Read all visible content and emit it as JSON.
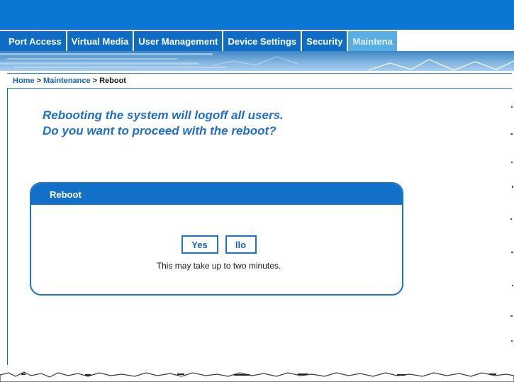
{
  "tabs": [
    {
      "label": "Port Access",
      "active": false
    },
    {
      "label": "Virtual Media",
      "active": false
    },
    {
      "label": "User Management",
      "active": false
    },
    {
      "label": "Device Settings",
      "active": false
    },
    {
      "label": "Security",
      "active": false
    },
    {
      "label": "Maintena",
      "active": true
    }
  ],
  "breadcrumb": {
    "home": "Home",
    "sep1": ">",
    "section": "Maintenance",
    "sep2": ">",
    "current": "Reboot"
  },
  "message": {
    "line1": "Rebooting the system will logoff all users.",
    "line2": "Do you want to proceed with the reboot?"
  },
  "panel": {
    "title": "Reboot",
    "yes_label": "Yes",
    "no_label": "llo",
    "note": "This may take up to two minutes."
  },
  "colors": {
    "brand_blue": "#0a78d2",
    "tab_blue": "#0f6cc4",
    "active_tab": "#58aee2",
    "text_blue": "#1f6fc8"
  }
}
